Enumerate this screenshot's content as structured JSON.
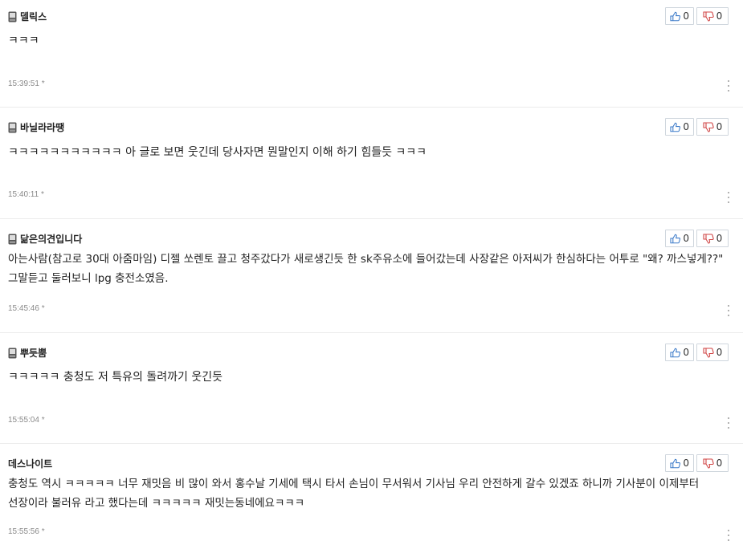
{
  "comments": [
    {
      "author": "델릭스",
      "mobile": true,
      "body": "ㅋㅋㅋ",
      "time": "15:39:51 *",
      "likes": "0",
      "dislikes": "0"
    },
    {
      "author": "바닐라라땡",
      "mobile": true,
      "body": "ㅋㅋㅋㅋㅋㅋㅋㅋㅋㅋㅋ 아 글로 보면 웃긴데 당사자면 뭔말인지 이해 하기 힘들듯 ㅋㅋㅋ",
      "time": "15:40:11 *",
      "likes": "0",
      "dislikes": "0"
    },
    {
      "author": "닮은의견입니다",
      "mobile": true,
      "body": "아는사람(참고로 30대 아줌마임)  디젤 쏘렌토 끌고  청주갔다가 새로생긴듯 한 sk주유소에 들어갔는데  사장같은 아저씨가  한심하다는 어투로  \"왜?  까스넣게??\"  그말듣고    둘러보니  lpg 충전소였음.",
      "time": "15:45:46 *",
      "likes": "0",
      "dislikes": "0"
    },
    {
      "author": "뿌듯뿜",
      "mobile": true,
      "body": "ㅋㅋㅋㅋㅋ 충청도 저 특유의 돌려까기 웃긴듯",
      "time": "15:55:04 *",
      "likes": "0",
      "dislikes": "0"
    },
    {
      "author": "데스나이트",
      "mobile": false,
      "body": "충청도 역시 ㅋㅋㅋㅋㅋ 너무 재밋음 비 많이 와서 홍수날 기세에 택시 타서 손님이 무서워서 기사님 우리 안전하게 갈수 있겠죠 하니까 기사분이 이제부터 선장이라 불러유 라고 했다는데 ㅋㅋㅋㅋㅋ 재밋는동네에요ㅋㅋㅋ",
      "time": "15:55:56 *",
      "likes": "0",
      "dislikes": "0"
    }
  ]
}
